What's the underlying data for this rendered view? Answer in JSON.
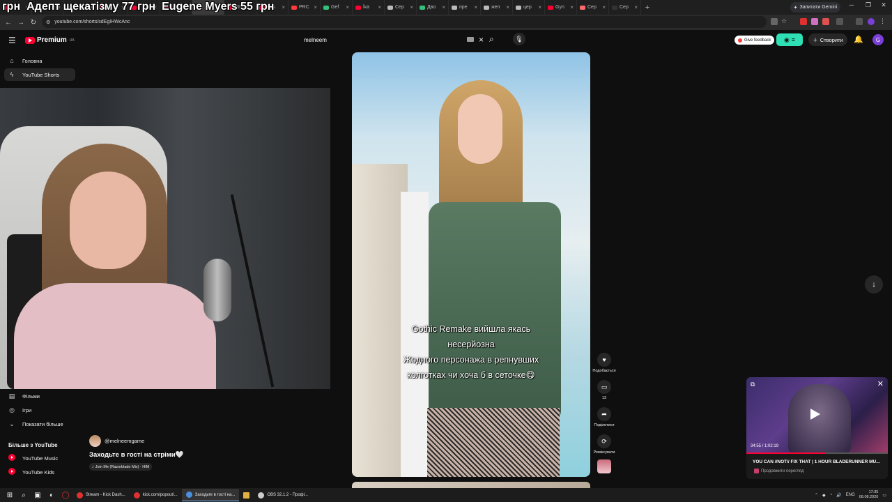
{
  "browser": {
    "tabs": [
      {
        "label": "грн",
        "color": "#ff0033"
      },
      {
        "label": "",
        "color": "#ff0033"
      },
      {
        "label": "",
        "color": "#ff0033"
      },
      {
        "label": "",
        "color": "#ff0033"
      },
      {
        "label": "",
        "color": "#ff0033"
      },
      {
        "label": "",
        "color": "#ff0033"
      },
      {
        "label": "",
        "color": "#ff0033",
        "active": true
      },
      {
        "label": "HIM",
        "color": "#ff0033"
      },
      {
        "label": "Pos",
        "color": "#ff0033"
      },
      {
        "label": "PRC",
        "color": "#ff3b3b"
      },
      {
        "label": "Gef",
        "color": "#35c07a"
      },
      {
        "label": "Їка",
        "color": "#ff0033"
      },
      {
        "label": "Сер",
        "color": "#bbbbbb"
      },
      {
        "label": "Дво",
        "color": "#35c07a"
      },
      {
        "label": "пре",
        "color": "#bbbbbb"
      },
      {
        "label": "жеп",
        "color": "#bbbbbb"
      },
      {
        "label": "цер",
        "color": "#bbbbbb"
      },
      {
        "label": "Gyn",
        "color": "#ff0033"
      },
      {
        "label": "Сер",
        "color": "#ff6b6b"
      },
      {
        "label": "Сер",
        "color": "#333333"
      }
    ],
    "gemini_label": "Запитати Gemini",
    "url": "youtube.com/shorts/sdEgIHWcAnc"
  },
  "donation_overlay": [
    "грн",
    "Адепт щекатізму  77 грн",
    "Eugene Myers  55 грн"
  ],
  "header": {
    "logo_text": "Premium",
    "logo_region": "UA",
    "search_value": "melneem",
    "feedback_label": "Give feedback",
    "create_label": "Створити",
    "avatar_letter": "G"
  },
  "sidebar": {
    "top_items": [
      {
        "label": "Головна",
        "icon": "home-icon",
        "active": false
      },
      {
        "label": "YouTube Shorts",
        "icon": "shorts-icon",
        "active": true
      }
    ],
    "lower_items": [
      {
        "label": "Фільми",
        "icon": "film-icon"
      },
      {
        "label": "Ігри",
        "icon": "gaming-icon"
      },
      {
        "label": "Показати більше",
        "icon": "chevron-down-icon"
      }
    ],
    "more_heading": "Більше з YouTube",
    "more_items": [
      {
        "label": "YouTube Music"
      },
      {
        "label": "YouTube Kids"
      }
    ]
  },
  "short": {
    "caption_lines": [
      "Gothic Remake вийшла якась",
      "несерйозна",
      "Жодного персонажа в репнувших",
      "колготках чи хоча б в сеточке😋"
    ],
    "channel": "@melneemgame",
    "title": "Заходьте в гості на стріми🤍",
    "music": "Join Me (Razorblade Mix) · HIM",
    "actions": {
      "like_label": "Подобається",
      "comments_count": "13",
      "share_label": "Поділитися",
      "remix_label": "Реміксувати"
    }
  },
  "miniplayer": {
    "time": "34:55 / 1:02:19",
    "progress": 0.56,
    "title": "YOU CAN //NOT// FIX THAT | 1 HOUR BLADERUNNER MU...",
    "resume_label": "Продовжити перегляд"
  },
  "taskbar": {
    "apps": [
      {
        "label": "Stream - Kick Dash...",
        "color": "#e03030"
      },
      {
        "label": "kick.com/popout/...",
        "color": "#e03030"
      },
      {
        "label": "Заходьте в гості на...",
        "color": "#4a90e2",
        "active": true
      },
      {
        "label": "",
        "color": "#e0b040"
      },
      {
        "label": "OBS 32.1.2 - Профі...",
        "color": "#cccccc"
      }
    ],
    "lang": "ENG",
    "time": "17:35",
    "date": "08.08.2026"
  }
}
